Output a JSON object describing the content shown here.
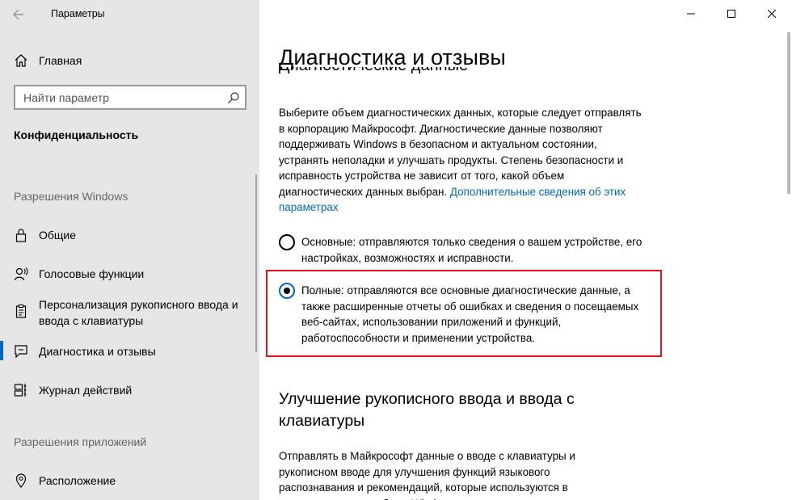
{
  "window": {
    "title": "Параметры"
  },
  "sidebar": {
    "home_label": "Главная",
    "search_placeholder": "Найти параметр",
    "section_title": "Конфиденциальность",
    "group_windows": "Разрешения Windows",
    "items_windows": [
      {
        "label": "Общие",
        "icon": "lock-icon"
      },
      {
        "label": "Голосовые функции",
        "icon": "speech-icon"
      },
      {
        "label": "Персонализация рукописного ввода и ввода с клавиатуры",
        "icon": "clipboard-icon"
      },
      {
        "label": "Диагностика и отзывы",
        "icon": "feedback-icon",
        "active": true
      },
      {
        "label": "Журнал действий",
        "icon": "timeline-icon"
      }
    ],
    "group_apps": "Разрешения приложений",
    "items_apps": [
      {
        "label": "Расположение",
        "icon": "location-icon"
      }
    ]
  },
  "main": {
    "page_title": "Диагностика и отзывы",
    "cut_heading": "Диагностические данные",
    "intro_text": "Выберите объем диагностических данных, которые следует отправлять в корпорацию Майкрософт. Диагностические данные позволяют поддерживать Windows в безопасном и актуальном состоянии, устранять неполадки и улучшать продукты. Степень безопасности и исправность устройства не зависит от того, какой объем диагностических данных выбран.",
    "intro_link": "Дополнительные сведения об этих параметрах",
    "options": [
      {
        "label": "Основные: отправляются только сведения о вашем устройстве, его настройках, возможностях и исправности.",
        "checked": false
      },
      {
        "label": "Полные: отправляются все основные диагностические данные, а также расширенные отчеты об ошибках и сведения о посещаемых веб-сайтах, использовании приложений и функций, работоспособности и применении устройства.",
        "checked": true
      }
    ],
    "section2_title": "Улучшение рукописного ввода и ввода с клавиатуры",
    "section2_text": "Отправлять в Майкрософт данные о вводе с клавиатуры и рукописном вводе для улучшения функций языкового распознавания и рекомендаций, которые используются в приложениях и службах в Windows."
  },
  "colors": {
    "accent": "#0067c0",
    "highlight": "#e3121b",
    "sidebar_bg": "#e6e6e6"
  }
}
